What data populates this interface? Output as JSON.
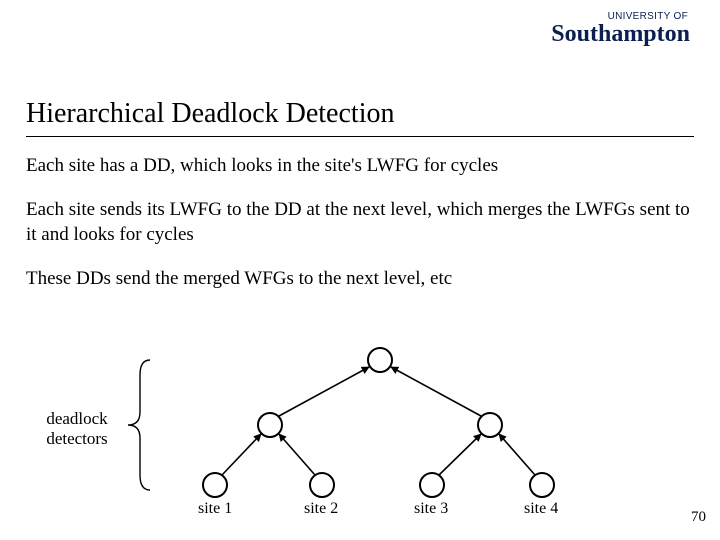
{
  "logo": {
    "small": "UNIVERSITY OF",
    "big": "Southampton"
  },
  "title": "Hierarchical Deadlock Detection",
  "paragraphs": {
    "p1": "Each site has a DD, which looks in the site's LWFG for cycles",
    "p2": "Each site sends its LWFG to the DD at the next level, which merges the LWFGs sent to it and looks for cycles",
    "p3": "These DDs send the merged WFGs to the next level, etc"
  },
  "left_label": {
    "line1": "deadlock",
    "line2": "detectors"
  },
  "sites": {
    "s1": "site 1",
    "s2": "site 2",
    "s3": "site 3",
    "s4": "site 4"
  },
  "page_number": "70"
}
